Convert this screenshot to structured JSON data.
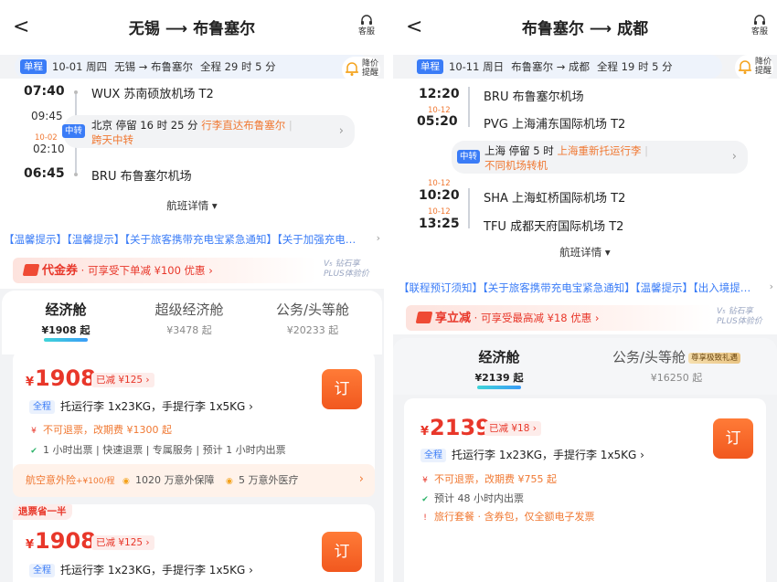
{
  "left": {
    "back": "<",
    "title": "无锡 ⟶ 布鲁塞尔",
    "service": "客服",
    "trip": {
      "tag": "单程",
      "date": "10-01 周四",
      "route": "无锡 → 布鲁塞尔",
      "duration": "全程 29 时 5 分"
    },
    "alert": {
      "l1": "降价",
      "l2": "提醒"
    },
    "dep_time": "07:40",
    "dep_airport": "WUX 苏南硕放机场 T2",
    "mid_time_1": "09:45",
    "mid_date_2": "10-02",
    "mid_time_2": "02:10",
    "transfer": {
      "tag": "中转",
      "city_stop": "北京  停留 16 时 25 分",
      "tip1": "行李直达布鲁塞尔",
      "sep": "|",
      "tip2": "跨天中转"
    },
    "arr_time": "06:45",
    "arr_airport": "BRU 布鲁塞尔机场",
    "detail": "航班详情 ▾",
    "notice": "【温馨提示】【温馨提示】【关于旅客携带充电宝紧急通知】【关于加强充电…",
    "coupon": {
      "name": "代金券",
      "text": "· 可享受下单减 ¥100 优惠",
      "arrow": "›"
    },
    "plus": {
      "l1": "V₅ 钻石享",
      "l2": "PLUS体验价"
    },
    "cabins": [
      {
        "name": "经济舱",
        "price": "¥1908 起"
      },
      {
        "name": "超级经济舱",
        "price": "¥3478 起"
      },
      {
        "name": "公务/头等舱",
        "price": "¥20233 起"
      }
    ],
    "card1": {
      "currency": "¥",
      "price": "1908",
      "discount": "已减 ¥125 ›",
      "book": "订",
      "tag": "全程",
      "bag": "托运行李 1x23KG，手提行李 1x5KG ›",
      "refund": "不可退票，改期费 ¥1300 起",
      "ticket": "1 小时出票 | 快速退票 | 专属服务 | 预计 1 小时内出票"
    },
    "insurance": {
      "a": "航空意外险",
      "b": "+¥100/程",
      "c": "1020 万意外保障",
      "d": "5 万意外医疗"
    },
    "card2": {
      "badge": "退票省一半",
      "currency": "¥",
      "price": "1908",
      "discount": "已减 ¥125 ›",
      "book": "订",
      "tag": "全程",
      "bag": "托运行李 1x23KG，手提行李 1x5KG ›"
    }
  },
  "right": {
    "back": "<",
    "title": "布鲁塞尔 ⟶ 成都",
    "service": "客服",
    "trip": {
      "tag": "单程",
      "date": "10-11 周日",
      "route": "布鲁塞尔 → 成都",
      "duration": "全程 19 时 5 分"
    },
    "alert": {
      "l1": "降价",
      "l2": "提醒"
    },
    "t1": "12:20",
    "a1": "BRU 布鲁塞尔机场",
    "d2": "10-12",
    "t2": "05:20",
    "a2": "PVG 上海浦东国际机场 T2",
    "transfer": {
      "tag": "中转",
      "city_stop": "上海  停留 5 时",
      "tip1": "上海重新托运行李",
      "sep": "|",
      "tip2": "不同机场转机"
    },
    "d3": "10-12",
    "t3": "10:20",
    "a3": "SHA 上海虹桥国际机场 T2",
    "d4": "10-12",
    "t4": "13:25",
    "a4": "TFU 成都天府国际机场 T2",
    "detail": "航班详情 ▾",
    "notice": "【联程预订须知】【关于旅客携带充电宝紧急通知】【温馨提示】【出入境提…",
    "coupon": {
      "name": "享立减",
      "text": "· 可享受最高减 ¥18 优惠",
      "arrow": "›"
    },
    "plus": {
      "l1": "V₅ 钻石享",
      "l2": "PLUS体验价"
    },
    "cabins": [
      {
        "name": "经济舱",
        "price": "¥2139 起"
      },
      {
        "name": "公务/头等舱",
        "price": "¥16250 起",
        "badge": "尊享极致礼遇"
      }
    ],
    "card1": {
      "currency": "¥",
      "price": "2139",
      "discount": "已减 ¥18 ›",
      "book": "订",
      "tag": "全程",
      "bag": "托运行李 1x23KG，手提行李 1x5KG ›",
      "refund": "不可退票，改期费 ¥755 起",
      "ticket": "预计 48 小时内出票",
      "package": "旅行套餐 · 含券包，仅全额电子发票"
    }
  },
  "colors": {
    "accent": "#3a7cf7",
    "price": "#e8372a",
    "book": "#f1581f",
    "warn": "#f07832"
  }
}
